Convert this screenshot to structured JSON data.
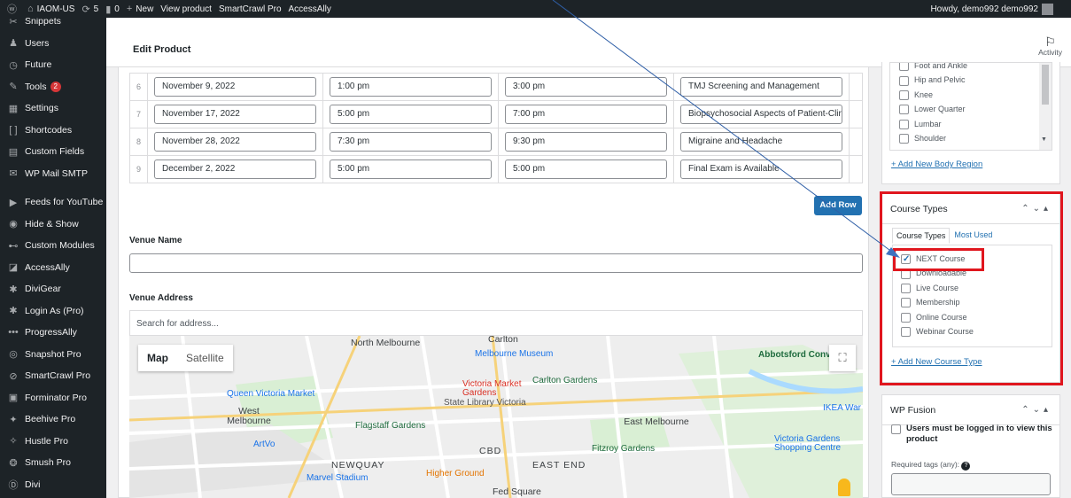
{
  "admin_bar": {
    "site_name": "IAOM-US",
    "updates_count": "5",
    "comments_count": "0",
    "new_label": "New",
    "view_product_label": "View product",
    "smartcrawl_label": "SmartCrawl Pro",
    "accessally_label": "AccessAlly",
    "howdy": "Howdy, demo992 demo992"
  },
  "sidebar": {
    "items": [
      {
        "label": "Snippets",
        "icon": "scissors-icon"
      },
      {
        "label": "Users",
        "icon": "users-icon"
      },
      {
        "label": "Future",
        "icon": "clock-icon"
      },
      {
        "label": "Tools",
        "icon": "wrench-icon",
        "badge": "2"
      },
      {
        "label": "Settings",
        "icon": "settings-icon"
      },
      {
        "label": "Shortcodes",
        "icon": "brackets-icon"
      },
      {
        "label": "Custom Fields",
        "icon": "custom-fields-icon"
      },
      {
        "label": "WP Mail SMTP",
        "icon": "mail-icon"
      },
      {
        "label": "Feeds for YouTube",
        "icon": "youtube-icon"
      },
      {
        "label": "Hide & Show",
        "icon": "eye-icon"
      },
      {
        "label": "Custom Modules",
        "icon": "modules-icon"
      },
      {
        "label": "AccessAlly",
        "icon": "accessally-icon"
      },
      {
        "label": "DiviGear",
        "icon": "gear-icon"
      },
      {
        "label": "Login As (Pro)",
        "icon": "gear-icon"
      },
      {
        "label": "ProgressAlly",
        "icon": "progress-icon"
      },
      {
        "label": "Snapshot Pro",
        "icon": "snapshot-icon"
      },
      {
        "label": "SmartCrawl Pro",
        "icon": "smartcrawl-icon"
      },
      {
        "label": "Forminator Pro",
        "icon": "forminator-icon"
      },
      {
        "label": "Beehive Pro",
        "icon": "beehive-icon"
      },
      {
        "label": "Hustle Pro",
        "icon": "hustle-icon"
      },
      {
        "label": "Smush Pro",
        "icon": "smush-icon"
      },
      {
        "label": "Divi",
        "icon": "divi-icon"
      }
    ]
  },
  "header": {
    "page_title": "Edit Product",
    "activity_label": "Activity"
  },
  "schedule": {
    "rows": [
      {
        "num": "6",
        "date": "November 9, 2022",
        "start": "1:00 pm",
        "end": "3:00 pm",
        "topic": "TMJ Screening and Management"
      },
      {
        "num": "7",
        "date": "November 17, 2022",
        "start": "5:00 pm",
        "end": "7:00 pm",
        "topic": "Biopsychosocial Aspects of Patient-Clir"
      },
      {
        "num": "8",
        "date": "November 28, 2022",
        "start": "7:30 pm",
        "end": "9:30 pm",
        "topic": "Migraine and Headache"
      },
      {
        "num": "9",
        "date": "December 2, 2022",
        "start": "5:00 pm",
        "end": "5:00 pm",
        "topic": "Final Exam is Available"
      }
    ],
    "add_row_label": "Add Row"
  },
  "venue": {
    "name_label": "Venue Name",
    "name_value": "",
    "address_label": "Venue Address",
    "search_placeholder": "Search for address..."
  },
  "map": {
    "map_label": "Map",
    "satellite_label": "Satellite",
    "labels": {
      "north_melbourne": "North Melbourne",
      "carlton_top": "Carlton",
      "melbourne_museum": "Melbourne Museum",
      "abbotsford_convent": "Abbotsford Convent",
      "queen_victoria_market": "Queen Victoria Market",
      "victoria_market_gardens": "Victoria Market Gardens",
      "carlton_gardens": "Carlton Gardens",
      "state_library": "State Library Victoria",
      "west_melbourne": "West Melbourne",
      "flagstaff_gardens": "Flagstaff Gardens",
      "east_melbourne": "East Melbourne",
      "fitzroy_gardens": "Fitzroy Gardens",
      "victoria_gardens": "Victoria Gardens Shopping Centre",
      "ikea": "IKEA War",
      "artvo": "ArtVo",
      "cbd": "CBD",
      "newquay": "NEWQUAY",
      "marvel_stadium": "Marvel Stadium",
      "higher_ground": "Higher Ground",
      "east_end": "EAST END",
      "fed_square": "Fed Square"
    }
  },
  "body_region": {
    "items": [
      "Foot and Ankle",
      "Hip and Pelvic",
      "Knee",
      "Lower Quarter",
      "Lumbar",
      "Shoulder"
    ],
    "add_link": "+ Add New Body Region"
  },
  "course_types": {
    "title": "Course Types",
    "tab_all": "Course Types",
    "tab_most_used": "Most Used",
    "items": [
      {
        "label": "NEXT Course",
        "checked": true
      },
      {
        "label": "Downloadable",
        "checked": false
      },
      {
        "label": "Live Course",
        "checked": false
      },
      {
        "label": "Membership",
        "checked": false
      },
      {
        "label": "Online Course",
        "checked": false
      },
      {
        "label": "Webinar Course",
        "checked": false
      }
    ],
    "add_link": "+ Add New Course Type"
  },
  "wp_fusion": {
    "title": "WP Fusion",
    "logged_in_label": "Users must be logged in to view this product",
    "required_tags_label": "Required tags (any):"
  },
  "colors": {
    "accent": "#2271b1",
    "highlight": "#e0161e",
    "admin_dark": "#1d2327"
  }
}
